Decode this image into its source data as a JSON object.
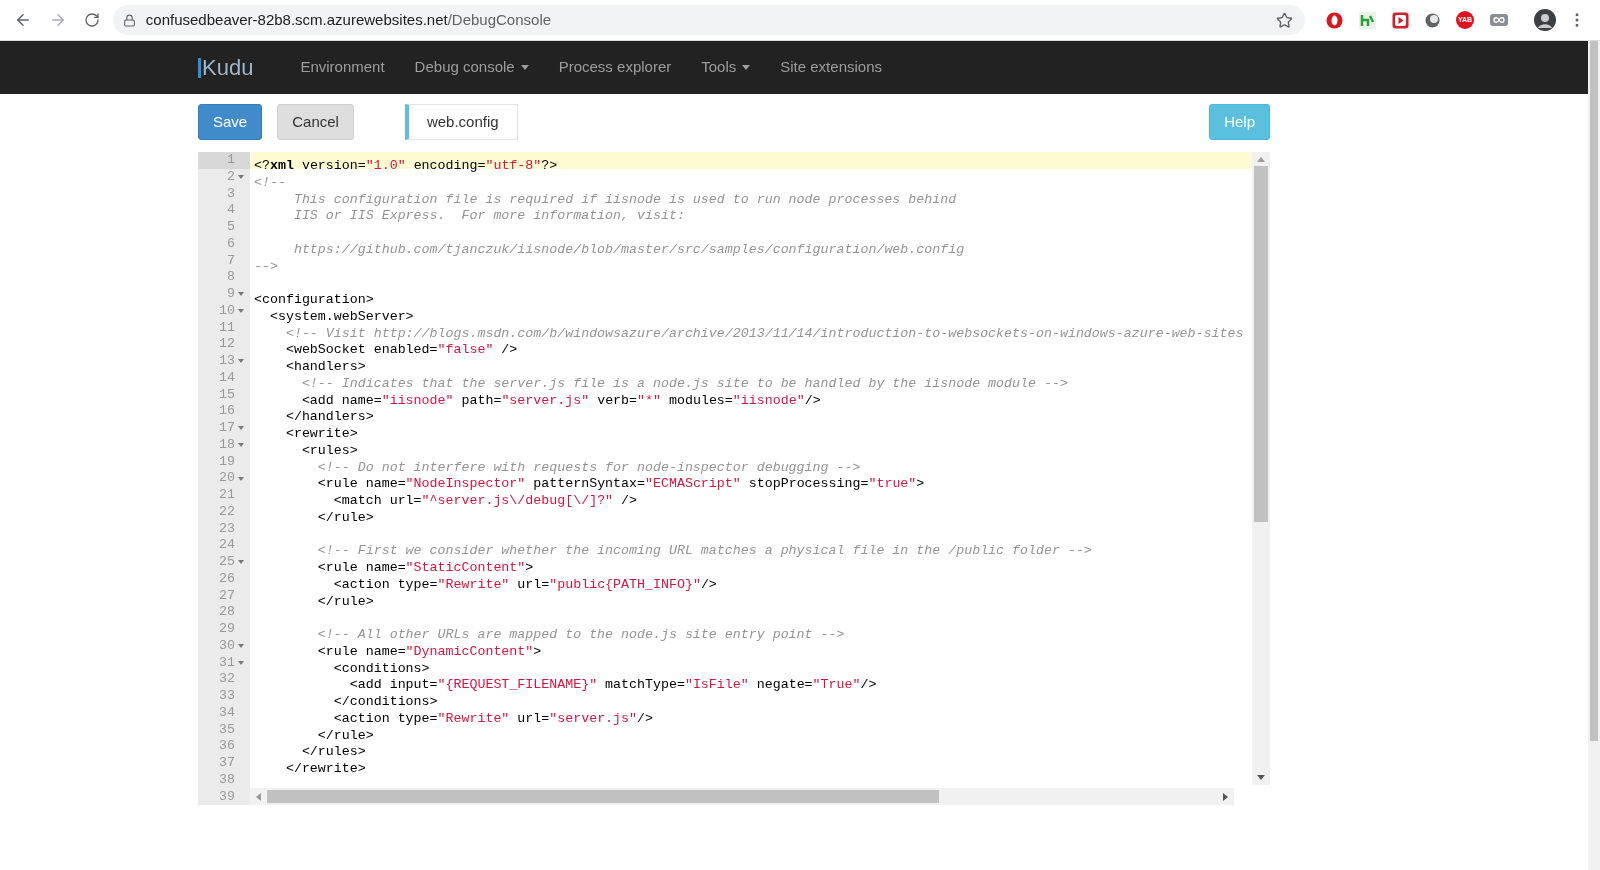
{
  "browser": {
    "url_host": "confusedbeaver-82b8.scm.azurewebsites.net",
    "url_path": "/DebugConsole",
    "extension_badge": "YAB"
  },
  "navbar": {
    "brand": "Kudu",
    "items": [
      {
        "label": "Environment",
        "dropdown": false
      },
      {
        "label": "Debug console",
        "dropdown": true
      },
      {
        "label": "Process explorer",
        "dropdown": false
      },
      {
        "label": "Tools",
        "dropdown": true
      },
      {
        "label": "Site extensions",
        "dropdown": false
      }
    ]
  },
  "toolbar": {
    "buttons": [
      {
        "label": "Save",
        "kind": "primary"
      },
      {
        "label": "Cancel",
        "kind": "default"
      }
    ],
    "file_tab": "web.config",
    "help_button": "Help"
  },
  "editor": {
    "lines": [
      {
        "number": "1",
        "foldable": false,
        "active": true,
        "tokens": [
          {
            "kind": "plain",
            "t": "<?"
          },
          {
            "kind": "bold",
            "t": "xml"
          },
          {
            "kind": "plain",
            "t": " version="
          },
          {
            "kind": "string",
            "t": "\"1.0\""
          },
          {
            "kind": "plain",
            "t": " encoding="
          },
          {
            "kind": "string",
            "t": "\"utf-8\""
          },
          {
            "kind": "plain",
            "t": "?>"
          }
        ]
      },
      {
        "number": "2",
        "foldable": true,
        "active": false,
        "tokens": [
          {
            "kind": "comment",
            "t": "<!--"
          }
        ]
      },
      {
        "number": "3",
        "foldable": false,
        "active": false,
        "tokens": [
          {
            "kind": "comment",
            "t": "     This configuration file is required if iisnode is used to run node processes behind"
          }
        ]
      },
      {
        "number": "4",
        "foldable": false,
        "active": false,
        "tokens": [
          {
            "kind": "comment",
            "t": "     IIS or IIS Express.  For more information, visit:"
          }
        ]
      },
      {
        "number": "5",
        "foldable": false,
        "active": false
      },
      {
        "number": "6",
        "foldable": false,
        "active": false,
        "tokens": [
          {
            "kind": "comment",
            "t": "     https://github.com/tjanczuk/iisnode/blob/master/src/samples/configuration/web.config"
          }
        ]
      },
      {
        "number": "7",
        "foldable": false,
        "active": false,
        "tokens": [
          {
            "kind": "comment",
            "t": "-->"
          }
        ]
      },
      {
        "number": "8",
        "foldable": false,
        "active": false
      },
      {
        "number": "9",
        "foldable": true,
        "active": false,
        "tokens": [
          {
            "kind": "plain",
            "t": "<configuration>"
          }
        ]
      },
      {
        "number": "10",
        "foldable": true,
        "active": false,
        "tokens": [
          {
            "kind": "plain",
            "t": "  <system.webServer>"
          }
        ]
      },
      {
        "number": "11",
        "foldable": false,
        "active": false,
        "tokens": [
          {
            "kind": "comment",
            "t": "    <!-- Visit http://blogs.msdn.com/b/windowsazure/archive/2013/11/14/introduction-to-websockets-on-windows-azure-web-sites"
          }
        ]
      },
      {
        "number": "12",
        "foldable": false,
        "active": false,
        "tokens": [
          {
            "kind": "plain",
            "t": "    <webSocket enabled="
          },
          {
            "kind": "string",
            "t": "\"false\""
          },
          {
            "kind": "plain",
            "t": " />"
          }
        ]
      },
      {
        "number": "13",
        "foldable": true,
        "active": false,
        "tokens": [
          {
            "kind": "plain",
            "t": "    <handlers>"
          }
        ]
      },
      {
        "number": "14",
        "foldable": false,
        "active": false,
        "tokens": [
          {
            "kind": "comment",
            "t": "      <!-- Indicates that the server.js file is a node.js site to be handled by the iisnode module -->"
          }
        ]
      },
      {
        "number": "15",
        "foldable": false,
        "active": false,
        "tokens": [
          {
            "kind": "plain",
            "t": "      <add name="
          },
          {
            "kind": "string",
            "t": "\"iisnode\""
          },
          {
            "kind": "plain",
            "t": " path="
          },
          {
            "kind": "string",
            "t": "\"server.js\""
          },
          {
            "kind": "plain",
            "t": " verb="
          },
          {
            "kind": "string",
            "t": "\"*\""
          },
          {
            "kind": "plain",
            "t": " modules="
          },
          {
            "kind": "string",
            "t": "\"iisnode\""
          },
          {
            "kind": "plain",
            "t": "/>"
          }
        ]
      },
      {
        "number": "16",
        "foldable": false,
        "active": false,
        "tokens": [
          {
            "kind": "plain",
            "t": "    </handlers>"
          }
        ]
      },
      {
        "number": "17",
        "foldable": true,
        "active": false,
        "tokens": [
          {
            "kind": "plain",
            "t": "    <rewrite>"
          }
        ]
      },
      {
        "number": "18",
        "foldable": true,
        "active": false,
        "tokens": [
          {
            "kind": "plain",
            "t": "      <rules>"
          }
        ]
      },
      {
        "number": "19",
        "foldable": false,
        "active": false,
        "tokens": [
          {
            "kind": "comment",
            "t": "        <!-- Do not interfere with requests for node-inspector debugging -->"
          }
        ]
      },
      {
        "number": "20",
        "foldable": true,
        "active": false,
        "tokens": [
          {
            "kind": "plain",
            "t": "        <rule name="
          },
          {
            "kind": "string",
            "t": "\"NodeInspector\""
          },
          {
            "kind": "plain",
            "t": " patternSyntax="
          },
          {
            "kind": "string",
            "t": "\"ECMAScript\""
          },
          {
            "kind": "plain",
            "t": " stopProcessing="
          },
          {
            "kind": "string",
            "t": "\"true\""
          },
          {
            "kind": "plain",
            "t": ">"
          }
        ]
      },
      {
        "number": "21",
        "foldable": false,
        "active": false,
        "tokens": [
          {
            "kind": "plain",
            "t": "          <match url="
          },
          {
            "kind": "string",
            "t": "\"^server.js\\/debug[\\/]?\""
          },
          {
            "kind": "plain",
            "t": " />"
          }
        ]
      },
      {
        "number": "22",
        "foldable": false,
        "active": false,
        "tokens": [
          {
            "kind": "plain",
            "t": "        </rule>"
          }
        ]
      },
      {
        "number": "23",
        "foldable": false,
        "active": false
      },
      {
        "number": "24",
        "foldable": false,
        "active": false,
        "tokens": [
          {
            "kind": "comment",
            "t": "        <!-- First we consider whether the incoming URL matches a physical file in the /public folder -->"
          }
        ]
      },
      {
        "number": "25",
        "foldable": true,
        "active": false,
        "tokens": [
          {
            "kind": "plain",
            "t": "        <rule name="
          },
          {
            "kind": "string",
            "t": "\"StaticContent\""
          },
          {
            "kind": "plain",
            "t": ">"
          }
        ]
      },
      {
        "number": "26",
        "foldable": false,
        "active": false,
        "tokens": [
          {
            "kind": "plain",
            "t": "          <action type="
          },
          {
            "kind": "string",
            "t": "\"Rewrite\""
          },
          {
            "kind": "plain",
            "t": " url="
          },
          {
            "kind": "string",
            "t": "\"public{PATH_INFO}\""
          },
          {
            "kind": "plain",
            "t": "/>"
          }
        ]
      },
      {
        "number": "27",
        "foldable": false,
        "active": false,
        "tokens": [
          {
            "kind": "plain",
            "t": "        </rule>"
          }
        ]
      },
      {
        "number": "28",
        "foldable": false,
        "active": false
      },
      {
        "number": "29",
        "foldable": false,
        "active": false,
        "tokens": [
          {
            "kind": "comment",
            "t": "        <!-- All other URLs are mapped to the node.js site entry point -->"
          }
        ]
      },
      {
        "number": "30",
        "foldable": true,
        "active": false,
        "tokens": [
          {
            "kind": "plain",
            "t": "        <rule name="
          },
          {
            "kind": "string",
            "t": "\"DynamicContent\""
          },
          {
            "kind": "plain",
            "t": ">"
          }
        ]
      },
      {
        "number": "31",
        "foldable": true,
        "active": false,
        "tokens": [
          {
            "kind": "plain",
            "t": "          <conditions>"
          }
        ]
      },
      {
        "number": "32",
        "foldable": false,
        "active": false,
        "tokens": [
          {
            "kind": "plain",
            "t": "            <add input="
          },
          {
            "kind": "string",
            "t": "\"{REQUEST_FILENAME}\""
          },
          {
            "kind": "plain",
            "t": " matchType="
          },
          {
            "kind": "string",
            "t": "\"IsFile\""
          },
          {
            "kind": "plain",
            "t": " negate="
          },
          {
            "kind": "string",
            "t": "\"True\""
          },
          {
            "kind": "plain",
            "t": "/>"
          }
        ]
      },
      {
        "number": "33",
        "foldable": false,
        "active": false,
        "tokens": [
          {
            "kind": "plain",
            "t": "          </conditions>"
          }
        ]
      },
      {
        "number": "34",
        "foldable": false,
        "active": false,
        "tokens": [
          {
            "kind": "plain",
            "t": "          <action type="
          },
          {
            "kind": "string",
            "t": "\"Rewrite\""
          },
          {
            "kind": "plain",
            "t": " url="
          },
          {
            "kind": "string",
            "t": "\"server.js\""
          },
          {
            "kind": "plain",
            "t": "/>"
          }
        ]
      },
      {
        "number": "35",
        "foldable": false,
        "active": false,
        "tokens": [
          {
            "kind": "plain",
            "t": "        </rule>"
          }
        ]
      },
      {
        "number": "36",
        "foldable": false,
        "active": false,
        "tokens": [
          {
            "kind": "plain",
            "t": "      </rules>"
          }
        ]
      },
      {
        "number": "37",
        "foldable": false,
        "active": false,
        "tokens": [
          {
            "kind": "plain",
            "t": "    </rewrite>"
          }
        ]
      },
      {
        "number": "38",
        "foldable": false,
        "active": false
      },
      {
        "number": "39",
        "foldable": false,
        "active": false
      }
    ]
  }
}
